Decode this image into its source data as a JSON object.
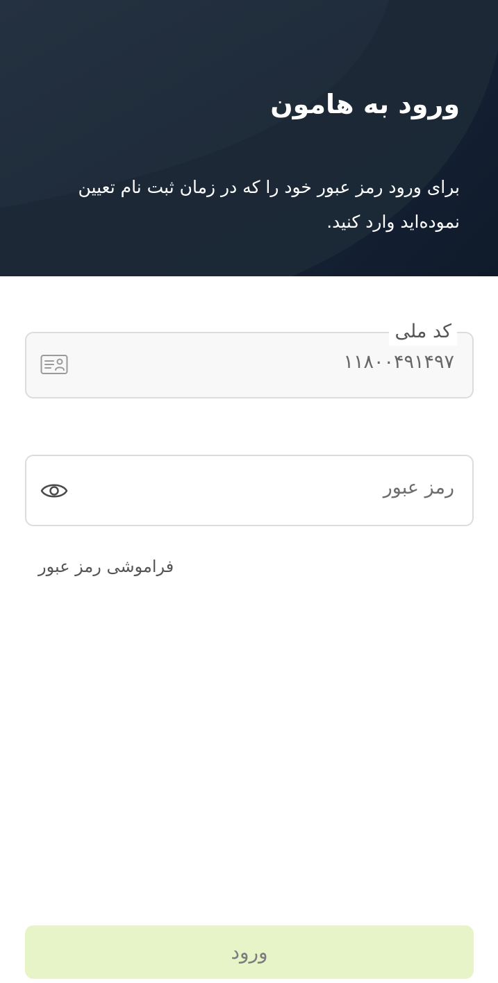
{
  "header": {
    "title": "ورود به هامون",
    "subtitle": "برای ورود رمز عبور خود را که در زمان ثبت نام تعیین نموده‌اید وارد کنید."
  },
  "national_code_field": {
    "label": "کد ملی",
    "value": "۱۱۸۰۰۴۹۱۴۹۷",
    "icon": "id-card-icon"
  },
  "password_field": {
    "placeholder": "رمز عبور",
    "icon": "eye-icon"
  },
  "forgot_password": {
    "label": "فراموشی رمز عبور"
  },
  "login_button": {
    "label": "ورود"
  },
  "colors": {
    "header_bg": "#1f2b39",
    "button_bg": "#e6f4c8",
    "field_border": "#dcdcdc"
  }
}
